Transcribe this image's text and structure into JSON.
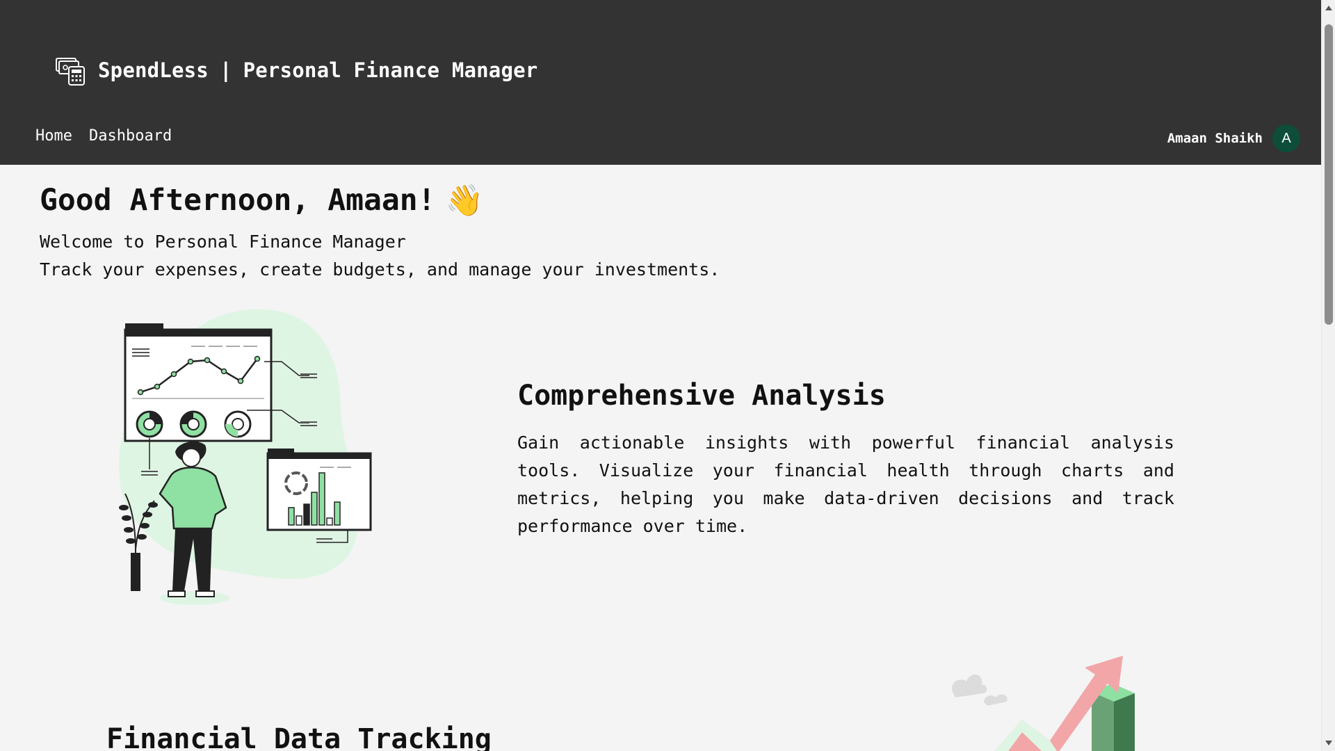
{
  "app": {
    "brand_name": "SpendLess",
    "separator": "|",
    "subtitle": "Personal Finance Manager",
    "logo_icon": "cash-calculator-icon"
  },
  "nav": {
    "home": "Home",
    "dashboard": "Dashboard"
  },
  "user": {
    "name": "Amaan Shaikh",
    "initial": "A",
    "avatar_color": "#0d4d3a"
  },
  "greeting": {
    "text": "Good Afternoon, Amaan!",
    "emoji": "👋",
    "line1": "Welcome to Personal Finance Manager",
    "line2": "Track your expenses, create budgets, and manage your investments."
  },
  "sections": [
    {
      "title": "Comprehensive Analysis",
      "description": "Gain actionable insights with powerful financial analysis tools. Visualize your financial health through charts and metrics, helping you make data-driven decisions and track performance over time.",
      "illustration": "person-viewing-charts-illustration"
    },
    {
      "title": "Financial Data Tracking",
      "illustration": "growth-arrow-illustration"
    }
  ],
  "colors": {
    "header_bg": "#333333",
    "page_bg": "#f4f4f4",
    "accent_green": "#8fe0a3",
    "light_green": "#dff5e4"
  }
}
